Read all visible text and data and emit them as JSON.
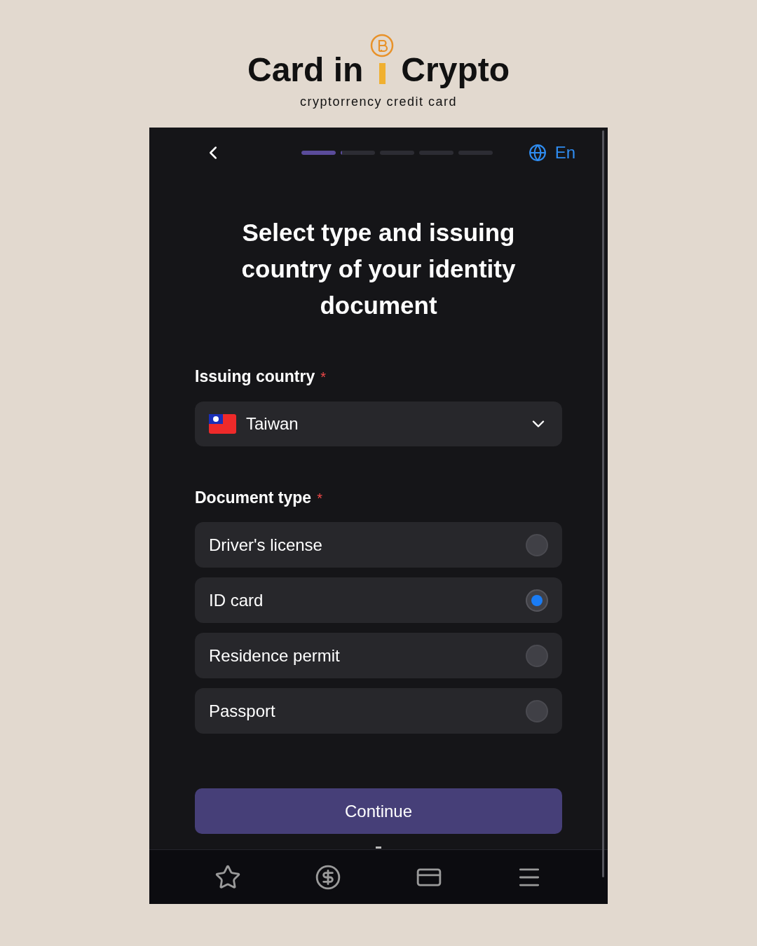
{
  "brand": {
    "name_left": "Card in",
    "name_right": "Crypto",
    "tagline": "cryptorrency credit card"
  },
  "header": {
    "language": "En",
    "steps": [
      {
        "level": 1
      },
      {
        "level": 0.05
      },
      {
        "level": 0
      },
      {
        "level": 0
      },
      {
        "level": 0
      }
    ]
  },
  "title": "Select type and issuing country of your identity document",
  "issuing_country": {
    "label": "Issuing country",
    "required_mark": "*",
    "value": "Taiwan"
  },
  "document_type": {
    "label": "Document type",
    "required_mark": "*",
    "options": [
      {
        "label": "Driver's license",
        "selected": false
      },
      {
        "label": "ID card",
        "selected": true
      },
      {
        "label": "Residence permit",
        "selected": false
      },
      {
        "label": "Passport",
        "selected": false
      }
    ]
  },
  "continue_button": "Continue",
  "bottom_nav": [
    {
      "kind": "star"
    },
    {
      "kind": "dollar"
    },
    {
      "kind": "card"
    },
    {
      "kind": "menu"
    }
  ]
}
